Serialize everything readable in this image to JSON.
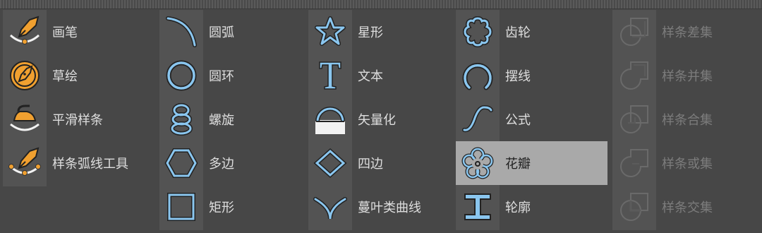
{
  "columns": [
    {
      "items": [
        {
          "label": "画笔",
          "icon": "pen-nib-curve-icon"
        },
        {
          "label": "草绘",
          "icon": "sketch-nib-circle-icon"
        },
        {
          "label": "平滑样条",
          "icon": "smooth-iron-icon"
        },
        {
          "label": "样条弧线工具",
          "icon": "spline-arc-pen-icon"
        }
      ]
    },
    {
      "items": [
        {
          "label": "圆弧",
          "icon": "arc-icon"
        },
        {
          "label": "圆环",
          "icon": "circle-icon"
        },
        {
          "label": "螺旋",
          "icon": "helix-icon"
        },
        {
          "label": "多边",
          "icon": "hexagon-icon"
        },
        {
          "label": "矩形",
          "icon": "rectangle-icon"
        }
      ]
    },
    {
      "items": [
        {
          "label": "星形",
          "icon": "star-icon"
        },
        {
          "label": "文本",
          "icon": "text-t-icon"
        },
        {
          "label": "矢量化",
          "icon": "vectorize-icon"
        },
        {
          "label": "四边",
          "icon": "diamond-icon"
        },
        {
          "label": "蔓叶类曲线",
          "icon": "cissoid-icon"
        }
      ]
    },
    {
      "items": [
        {
          "label": "齿轮",
          "icon": "gear-icon"
        },
        {
          "label": "摆线",
          "icon": "cycloid-icon"
        },
        {
          "label": "公式",
          "icon": "formula-wave-icon"
        },
        {
          "label": "花瓣",
          "icon": "flower-icon",
          "selected": true
        },
        {
          "label": "轮廓",
          "icon": "profile-i-beam-icon"
        }
      ]
    },
    {
      "items": [
        {
          "label": "样条差集",
          "icon": "spline-subtract-icon",
          "disabled": true
        },
        {
          "label": "样条并集",
          "icon": "spline-union-icon",
          "disabled": true
        },
        {
          "label": "样条合集",
          "icon": "spline-and-icon",
          "disabled": true
        },
        {
          "label": "样条或集",
          "icon": "spline-or-icon",
          "disabled": true
        },
        {
          "label": "样条交集",
          "icon": "spline-intersect-icon",
          "disabled": true
        }
      ]
    }
  ],
  "colors": {
    "background": "#474747",
    "icon_strip": "#535353",
    "selected": "#a9a9a9",
    "accent_blue": "#8ac6ef",
    "accent_orange": "#f0a030",
    "disabled": "#7c7c7c"
  }
}
